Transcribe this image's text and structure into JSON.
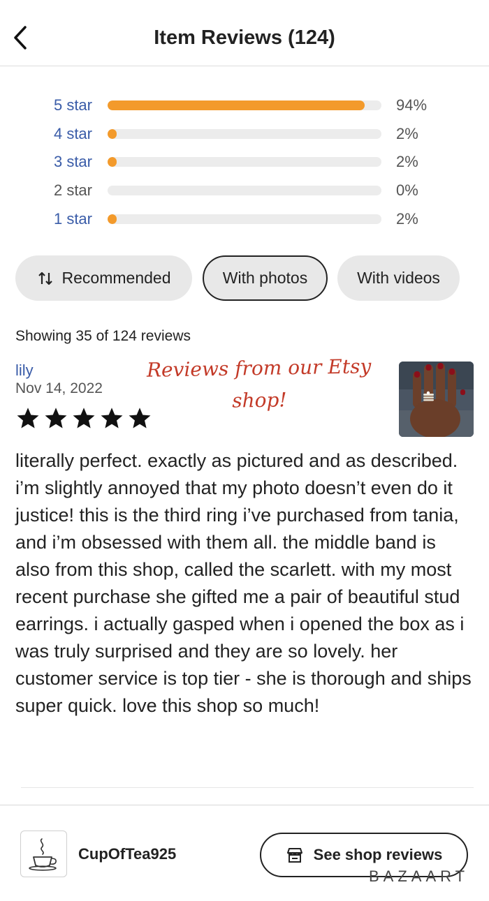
{
  "header": {
    "title": "Item Reviews (124)",
    "back_icon": "chevron-left-icon"
  },
  "rating_distribution": [
    {
      "label": "5 star",
      "percent": 94,
      "percent_text": "94%",
      "link": true
    },
    {
      "label": "4 star",
      "percent": 2,
      "percent_text": "2%",
      "link": true
    },
    {
      "label": "3 star",
      "percent": 2,
      "percent_text": "2%",
      "link": true
    },
    {
      "label": "2 star",
      "percent": 0,
      "percent_text": "0%",
      "link": false
    },
    {
      "label": "1 star",
      "percent": 2,
      "percent_text": "2%",
      "link": true
    }
  ],
  "filters": {
    "recommended": "Recommended",
    "with_photos": "With photos",
    "with_videos": "With videos",
    "sort_icon": "sort-icon"
  },
  "showing_text": "Showing 35 of 124 reviews",
  "review": {
    "reviewer": "lily",
    "date": "Nov 14, 2022",
    "rating": 5,
    "annotation_line1": "Reviews from our Etsy",
    "annotation_line2": "shop!",
    "body": "literally perfect. exactly as pictured and as described. i’m slightly annoyed that my photo doesn’t even do it justice! this is the third ring i’ve purchased from tania, and i’m obsessed with them all. the middle band is also from this shop, called the scarlett. with my most recent purchase she gifted me a pair of beautiful stud earrings. i actually gasped when i opened the box as i was truly surprised and they are so lovely. her customer service is top tier - she is thorough and ships super quick. love this shop so much!"
  },
  "footer": {
    "shop_name": "CupOfTea925",
    "see_reviews_label": "See shop reviews",
    "store_icon": "store-icon",
    "watermark": "BAZAART"
  },
  "colors": {
    "accent_orange": "#f39a2b",
    "link_blue": "#3a5ca8",
    "annotation_red": "#c33a28"
  }
}
